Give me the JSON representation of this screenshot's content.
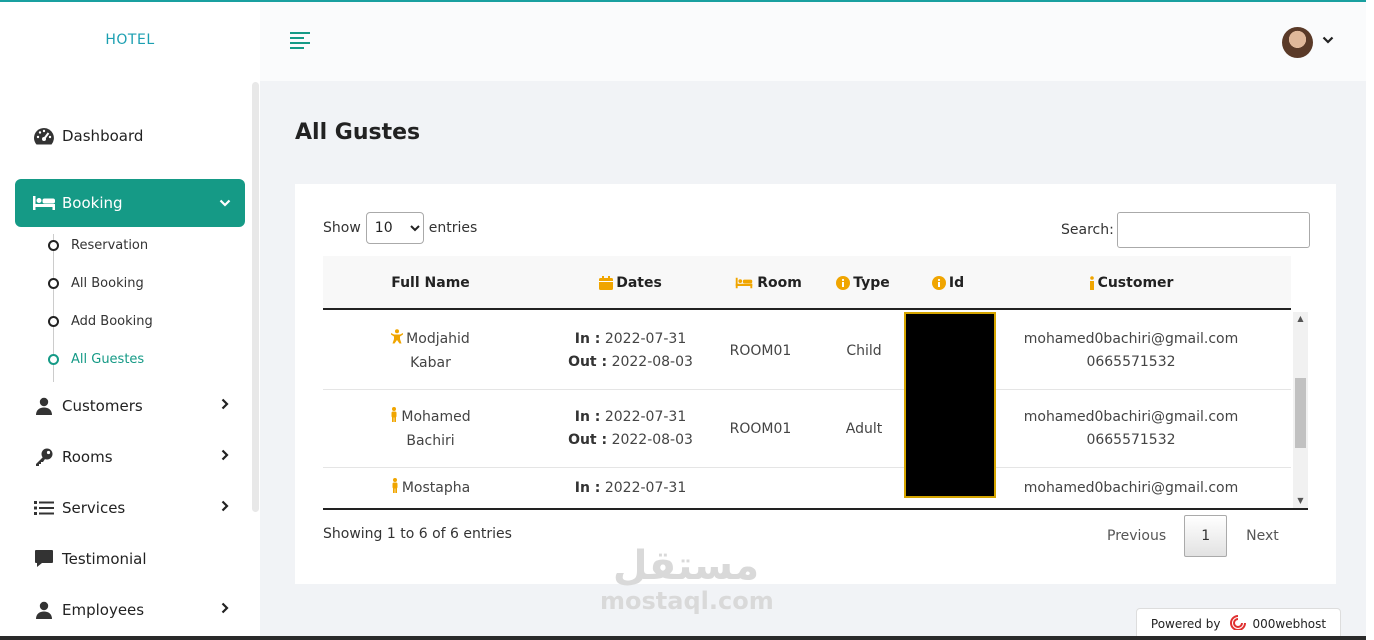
{
  "sidebar": {
    "brand": "HOTEL",
    "items": [
      {
        "label": "Dashboard",
        "icon": "tachometer-icon"
      },
      {
        "label": "Booking",
        "icon": "bed-icon",
        "active": true
      },
      {
        "label": "Customers",
        "icon": "user-icon"
      },
      {
        "label": "Rooms",
        "icon": "key-icon"
      },
      {
        "label": "Services",
        "icon": "list-icon"
      },
      {
        "label": "Testimonial",
        "icon": "comment-icon"
      },
      {
        "label": "Employees",
        "icon": "user-icon"
      }
    ],
    "booking_sub": [
      "Reservation",
      "All Booking",
      "Add Booking",
      "All Guestes"
    ]
  },
  "page": {
    "title": "All Gustes"
  },
  "table": {
    "length_label_pre": "Show",
    "length_value": "10",
    "length_label_post": "entries",
    "search_label": "Search:",
    "headers": [
      "Full Name",
      "Dates",
      "Room",
      "Type",
      "Id",
      "Customer"
    ],
    "rows": [
      {
        "name_first": "Modjahid",
        "name_last": "Kabar",
        "in_label": "In :",
        "in": "2022-07-31",
        "out_label": "Out :",
        "out": "2022-08-03",
        "room": "ROOM01",
        "type": "Child",
        "email": "mohamed0bachiri@gmail.com",
        "phone": "0665571532"
      },
      {
        "name_first": "Mohamed",
        "name_last": "Bachiri",
        "in_label": "In :",
        "in": "2022-07-31",
        "out_label": "Out :",
        "out": "2022-08-03",
        "room": "ROOM01",
        "type": "Adult",
        "email": "mohamed0bachiri@gmail.com",
        "phone": "0665571532"
      },
      {
        "name_first": "Mostapha",
        "name_last": "",
        "in_label": "In :",
        "in": "2022-07-31",
        "out_label": "",
        "out": "",
        "room": "",
        "type": "",
        "email": "mohamed0bachiri@gmail.com",
        "phone": ""
      }
    ],
    "info": "Showing 1 to 6 of 6 entries",
    "pagination": {
      "previous": "Previous",
      "current": "1",
      "next": "Next"
    }
  },
  "watermark": {
    "line1": "مستقل",
    "line2": "mostaql.com"
  },
  "footer_badge": {
    "prefix": "Powered by",
    "brand": "000webhost"
  },
  "colors": {
    "accent": "#159a86",
    "brand": "#1b9fb1",
    "icon_yellow": "#f0a500"
  }
}
